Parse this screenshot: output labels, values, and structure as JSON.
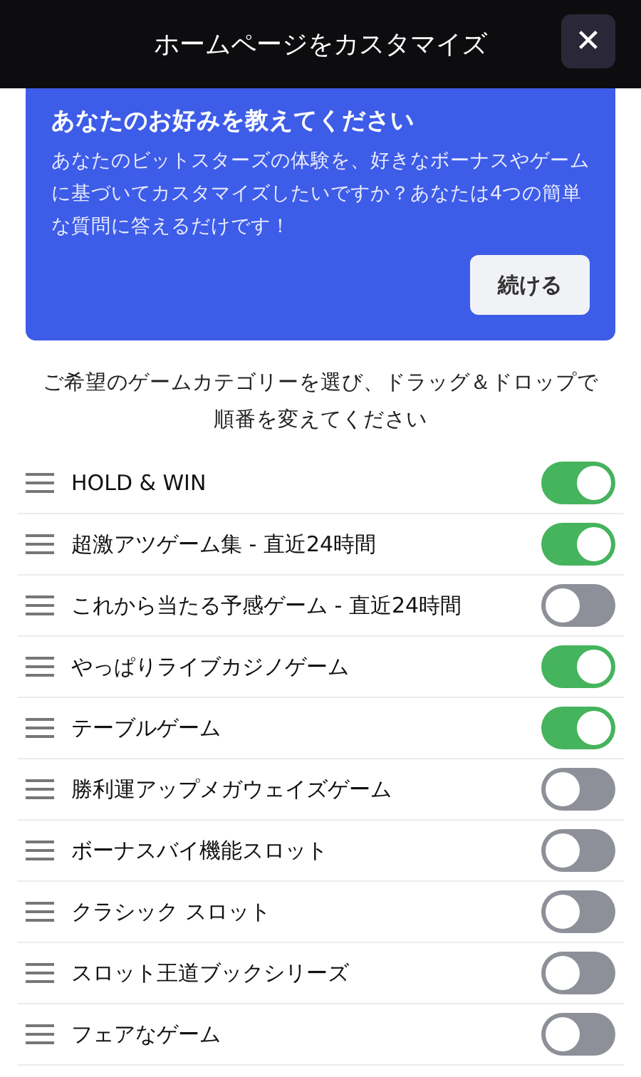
{
  "header": {
    "title": "ホームページをカスタマイズ",
    "close": "✕"
  },
  "promo": {
    "title": "あなたのお好みを教えてください",
    "body": "あなたのビットスターズの体験を、好きなボーナスやゲームに基づいてカスタマイズしたいですか？あなたは4つの簡単な質問に答えるだけです！",
    "button": "続ける"
  },
  "instruction": "ご希望のゲームカテゴリーを選び、ドラッグ＆ドロップで順番を変えてください",
  "categories": [
    {
      "label": "HOLD & WIN",
      "on": true
    },
    {
      "label": "超激アツゲーム集 - 直近24時間",
      "on": true
    },
    {
      "label": "これから当たる予感ゲーム - 直近24時間",
      "on": false
    },
    {
      "label": "やっぱりライブカジノゲーム",
      "on": true
    },
    {
      "label": "テーブルゲーム",
      "on": true
    },
    {
      "label": "勝利運アップメガウェイズゲーム",
      "on": false
    },
    {
      "label": "ボーナスバイ機能スロット",
      "on": false
    },
    {
      "label": "クラシック スロット",
      "on": false
    },
    {
      "label": "スロット王道ブックシリーズ",
      "on": false
    },
    {
      "label": "フェアなゲーム",
      "on": false
    }
  ]
}
